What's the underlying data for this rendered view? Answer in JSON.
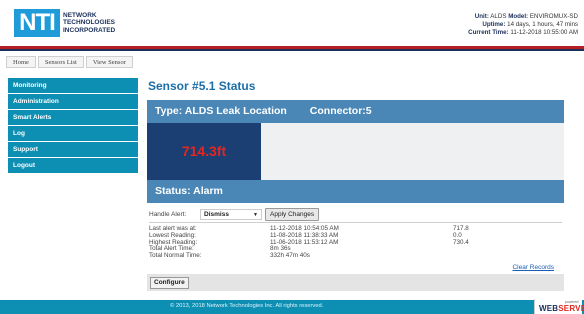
{
  "header": {
    "logo_mark": "NTI",
    "logo_lines": [
      "NETWORK",
      "TECHNOLOGIES",
      "INCORPORATED"
    ],
    "unit_label": "Unit:",
    "unit_value": "ALDS",
    "model_label": "Model:",
    "model_value": "ENVIROMUX-SD",
    "uptime_label": "Uptime:",
    "uptime_value": "14 days, 1 hours, 47 mins",
    "current_time_label": "Current Time:",
    "current_time_value": "11-12-2018 10:55:00 AM"
  },
  "breadcrumb": [
    "Home",
    "Sensors List",
    "View Sensor"
  ],
  "sidebar": {
    "items": [
      {
        "label": "Monitoring"
      },
      {
        "label": "Administration"
      },
      {
        "label": "Smart Alerts"
      },
      {
        "label": "Log"
      },
      {
        "label": "Support"
      },
      {
        "label": "Logout"
      }
    ]
  },
  "main": {
    "title": "Sensor #5.1 Status",
    "type_label": "Type: ALDS Leak Location",
    "connector_label": "Connector:5",
    "reading_value": "714.3ft",
    "status_label": "Status: Alarm",
    "handle_alert_label": "Handle Alert:",
    "handle_alert_selected": "Dismiss",
    "apply_button": "Apply Changes",
    "readings": [
      {
        "label": "Last alert was at:",
        "time": "11-12-2018 10:54:05 AM",
        "value": "717.8"
      },
      {
        "label": "Lowest Reading:",
        "time": "11-08-2018 11:38:33 AM",
        "value": "0.0"
      },
      {
        "label": "Highest Reading:",
        "time": "11-06-2018 11:53:12 AM",
        "value": "730.4"
      },
      {
        "label": "Total Alert Time:",
        "time": "8m 36s",
        "value": ""
      },
      {
        "label": "Total Normal Time:",
        "time": "332h 47m 40s",
        "value": ""
      }
    ],
    "clear_records": "Clear Records",
    "configure_button": "Configure"
  },
  "footer": {
    "copyright": "© 2013, 2018 Network Technologies Inc. All rights reserved.",
    "ws_top": "powered",
    "ws_web": "WEB",
    "ws_serve": "SERVE"
  },
  "colors": {
    "brand_blue": "#1e9bd8",
    "nav_teal": "#0d8fb3",
    "bar_blue": "#4a87b6",
    "value_box": "#1c3f73",
    "alarm_red": "#e32621",
    "stripe_red": "#b52025"
  }
}
